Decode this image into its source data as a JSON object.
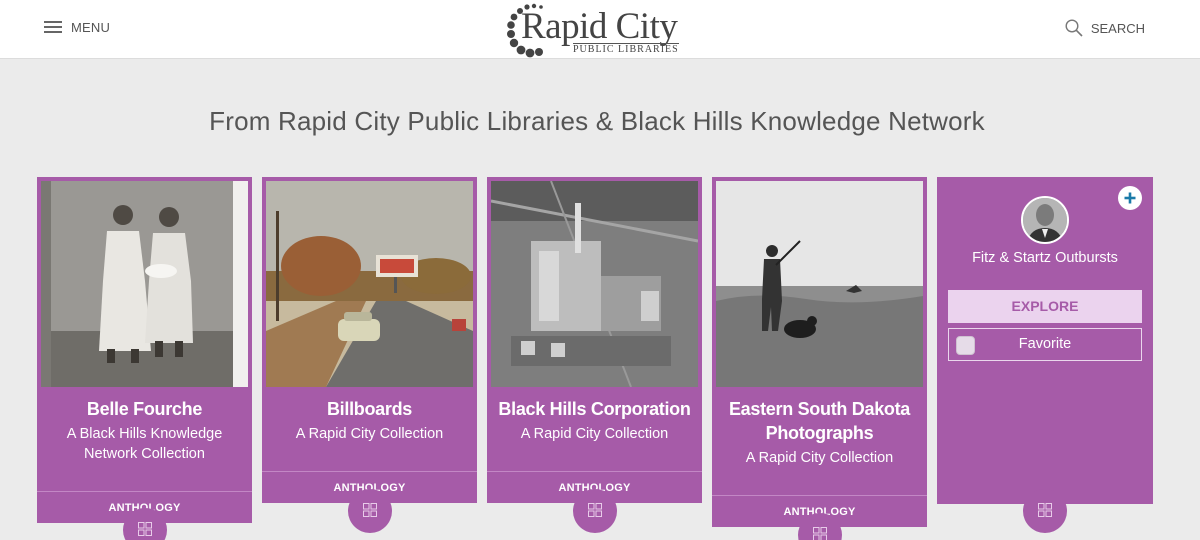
{
  "header": {
    "menu_label": "MENU",
    "logo_title": "Rapid City",
    "logo_subtitle": "PUBLIC LIBRARIES",
    "search_label": "SEARCH"
  },
  "page_title": "From Rapid City Public Libraries & Black Hills Knowledge Network",
  "colors": {
    "card_purple": "#a65ba8",
    "explore_bg": "#ebd3ee",
    "page_bg": "#ebebeb",
    "plus_icon": "#1a7aa8"
  },
  "cards": [
    {
      "title": "Belle Fourche",
      "subtitle": "A Black Hills Knowledge Network Collection",
      "footer": "ANTHOLOGY",
      "image": "sepia-photo-two-women"
    },
    {
      "title": "Billboards",
      "subtitle": "A Rapid City Collection",
      "footer": "ANTHOLOGY",
      "image": "street-with-billboard-and-car"
    },
    {
      "title": "Black Hills Corporation",
      "subtitle": "A Rapid City Collection",
      "footer": "ANTHOLOGY",
      "image": "aerial-power-plant-bw"
    },
    {
      "title": "Eastern South Dakota Photographs",
      "subtitle": "A Rapid City Collection",
      "footer": "ANTHOLOGY",
      "image": "hunter-with-dog-bw"
    }
  ],
  "feature": {
    "name": "Fitz & Startz Outbursts",
    "explore_label": "EXPLORE",
    "favorite_label": "Favorite",
    "avatar_image": "portrait-man-in-suit"
  }
}
